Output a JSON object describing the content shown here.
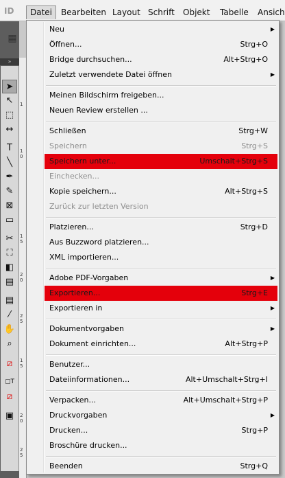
{
  "app": {
    "logo": "ID"
  },
  "menubar": [
    {
      "label": "Datei",
      "active": true
    },
    {
      "label": "Bearbeiten",
      "active": false
    },
    {
      "label": "Layout",
      "active": false
    },
    {
      "label": "Schrift",
      "active": false
    },
    {
      "label": "Objekt",
      "active": false
    },
    {
      "label": "Tabelle",
      "active": false
    },
    {
      "label": "Ansicht",
      "active": false
    }
  ],
  "menu": {
    "items": [
      {
        "label": "Neu",
        "shortcut": "",
        "submenu": true,
        "disabled": false,
        "highlight": false
      },
      {
        "label": "Öffnen...",
        "shortcut": "Strg+O",
        "submenu": false,
        "disabled": false,
        "highlight": false
      },
      {
        "label": "Bridge durchsuchen...",
        "shortcut": "Alt+Strg+O",
        "submenu": false,
        "disabled": false,
        "highlight": false
      },
      {
        "label": "Zuletzt verwendete Datei öffnen",
        "shortcut": "",
        "submenu": true,
        "disabled": false,
        "highlight": false
      },
      {
        "label": "Meinen Bildschirm freigeben...",
        "shortcut": "",
        "submenu": false,
        "disabled": false,
        "highlight": false
      },
      {
        "label": "Neuen Review erstellen ...",
        "shortcut": "",
        "submenu": false,
        "disabled": false,
        "highlight": false
      },
      {
        "label": "Schließen",
        "shortcut": "Strg+W",
        "submenu": false,
        "disabled": false,
        "highlight": false
      },
      {
        "label": "Speichern",
        "shortcut": "Strg+S",
        "submenu": false,
        "disabled": true,
        "highlight": false
      },
      {
        "label": "Speichern unter...",
        "shortcut": "Umschalt+Strg+S",
        "submenu": false,
        "disabled": false,
        "highlight": true
      },
      {
        "label": "Einchecken...",
        "shortcut": "",
        "submenu": false,
        "disabled": true,
        "highlight": false
      },
      {
        "label": "Kopie speichern...",
        "shortcut": "Alt+Strg+S",
        "submenu": false,
        "disabled": false,
        "highlight": false
      },
      {
        "label": "Zurück zur letzten Version",
        "shortcut": "",
        "submenu": false,
        "disabled": true,
        "highlight": false
      },
      {
        "label": "Platzieren...",
        "shortcut": "Strg+D",
        "submenu": false,
        "disabled": false,
        "highlight": false
      },
      {
        "label": "Aus Buzzword platzieren...",
        "shortcut": "",
        "submenu": false,
        "disabled": false,
        "highlight": false
      },
      {
        "label": "XML importieren...",
        "shortcut": "",
        "submenu": false,
        "disabled": false,
        "highlight": false
      },
      {
        "label": "Adobe PDF-Vorgaben",
        "shortcut": "",
        "submenu": true,
        "disabled": false,
        "highlight": false
      },
      {
        "label": "Exportieren...",
        "shortcut": "Strg+E",
        "submenu": false,
        "disabled": false,
        "highlight": true
      },
      {
        "label": "Exportieren in",
        "shortcut": "",
        "submenu": true,
        "disabled": false,
        "highlight": false
      },
      {
        "label": "Dokumentvorgaben",
        "shortcut": "",
        "submenu": true,
        "disabled": false,
        "highlight": false
      },
      {
        "label": "Dokument einrichten...",
        "shortcut": "Alt+Strg+P",
        "submenu": false,
        "disabled": false,
        "highlight": false
      },
      {
        "label": "Benutzer...",
        "shortcut": "",
        "submenu": false,
        "disabled": false,
        "highlight": false
      },
      {
        "label": "Dateiinformationen...",
        "shortcut": "Alt+Umschalt+Strg+I",
        "submenu": false,
        "disabled": false,
        "highlight": false
      },
      {
        "label": "Verpacken...",
        "shortcut": "Alt+Umschalt+Strg+P",
        "submenu": false,
        "disabled": false,
        "highlight": false
      },
      {
        "label": "Druckvorgaben",
        "shortcut": "",
        "submenu": true,
        "disabled": false,
        "highlight": false
      },
      {
        "label": "Drucken...",
        "shortcut": "Strg+P",
        "submenu": false,
        "disabled": false,
        "highlight": false
      },
      {
        "label": "Broschüre drucken...",
        "shortcut": "",
        "submenu": false,
        "disabled": false,
        "highlight": false
      },
      {
        "label": "Beenden",
        "shortcut": "Strg+Q",
        "submenu": false,
        "disabled": false,
        "highlight": false
      }
    ],
    "separators_after": [
      3,
      5,
      11,
      14,
      17,
      19,
      21,
      25
    ]
  },
  "ruler": [
    "1",
    "1\n0",
    "1\n5",
    "2\n0",
    "2\n5"
  ],
  "tools": [
    "selection-tool-icon",
    "direct-selection-tool-icon",
    "page-tool-icon",
    "gap-tool-icon",
    "type-tool-icon",
    "line-tool-icon",
    "pen-tool-icon",
    "pencil-tool-icon",
    "rectangle-frame-tool-icon",
    "rectangle-tool-icon",
    "scissors-tool-icon",
    "free-transform-tool-icon",
    "gradient-swatch-tool-icon",
    "gradient-feather-tool-icon",
    "note-tool-icon",
    "eyedropper-tool-icon",
    "hand-tool-icon",
    "zoom-tool-icon",
    "fill-stroke-icon",
    "formatting-affects-icon",
    "view-mode-icon",
    "screen-mode-icon"
  ],
  "colors": {
    "highlight": "#e4000b",
    "menu_bg": "#f0f0f0",
    "disabled": "#8d8d8d"
  }
}
